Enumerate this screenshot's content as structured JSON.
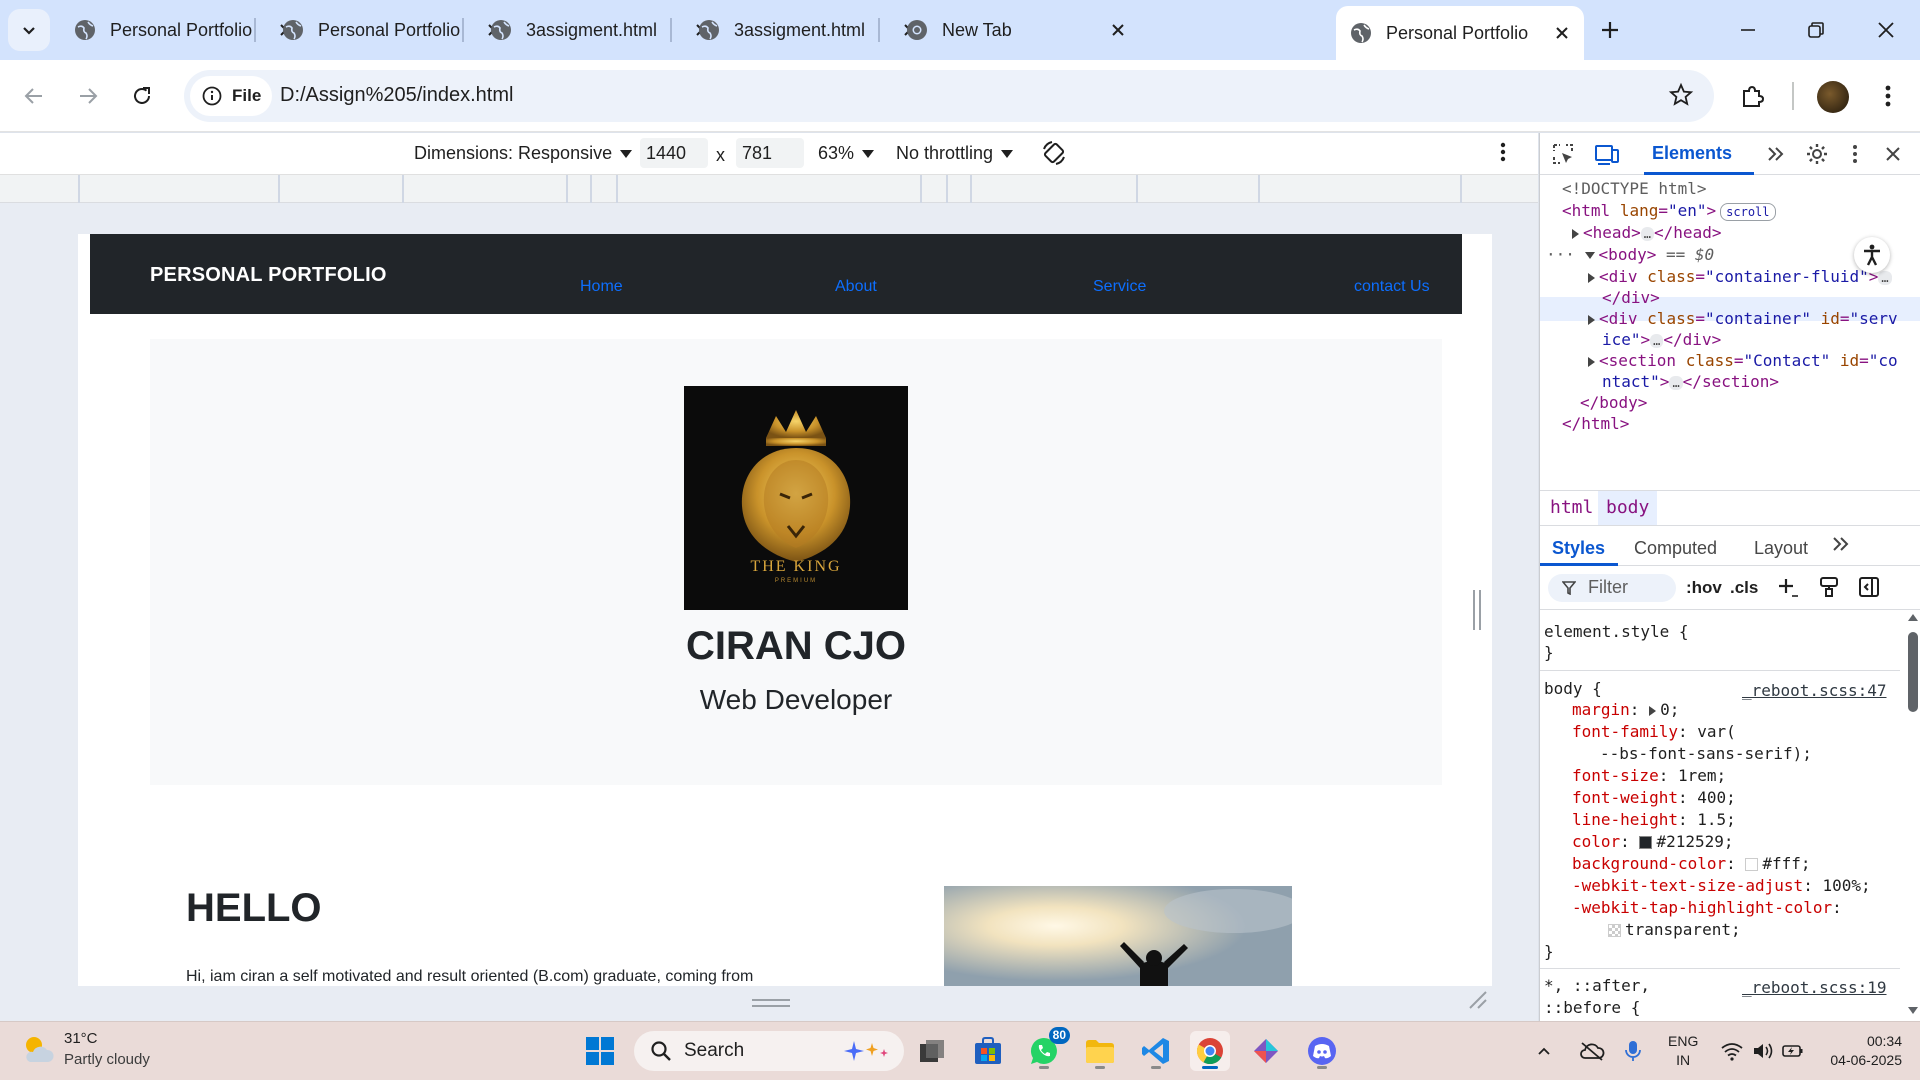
{
  "browser": {
    "tabs": [
      {
        "title": "Personal Portfolio",
        "active": false
      },
      {
        "title": "Personal Portfolio",
        "active": false
      },
      {
        "title": "3assigment.html",
        "active": false
      },
      {
        "title": "3assigment.html",
        "active": false
      },
      {
        "title": "New Tab",
        "active": false
      },
      {
        "title": "Personal Portfolio",
        "active": true
      }
    ],
    "address": {
      "chip": "File",
      "url": "D:/Assign%205/index.html"
    }
  },
  "device_toolbar": {
    "dimensions_label": "Dimensions: Responsive",
    "width": "1440",
    "times": "x",
    "height": "781",
    "zoom": "63%",
    "throttling": "No throttling"
  },
  "site": {
    "brand": "PERSONAL PORTFOLIO",
    "nav": [
      "Home",
      "About",
      "Service",
      "contact Us"
    ],
    "hero": {
      "logo_text": "THE KING",
      "logo_sub": "PREMIUM",
      "name": "CIRAN CJO",
      "role": "Web Developer"
    },
    "about": {
      "heading": "HELLO",
      "text": "Hi, iam ciran a self motivated and result oriented (B.com) graduate, coming from"
    }
  },
  "devtools": {
    "active_tab": "Elements",
    "dom": {
      "doctype": "<!DOCTYPE html>",
      "html_open_tag": "<html",
      "html_lang_attr": "lang",
      "html_lang_val": "\"en\"",
      "html_open_close": ">",
      "scroll_badge": "scroll",
      "head_open": "<head>",
      "head_close": "</head>",
      "body_open": "<body>",
      "body_eq": "== $0",
      "div1_tag": "<div",
      "div1_attr": "class",
      "div1_val": "\"container-fluid\"",
      "div1_end": ">",
      "div1_close": "</div>",
      "div2_tag": "<div",
      "div2_attr": "class",
      "div2_val": "\"container\"",
      "div2_attr2": "id",
      "div2_val2a": "\"serv",
      "div2_val2b": "ice\"",
      "div2_end": ">",
      "div2_close": "</div>",
      "section_tag": "<section",
      "section_attr": "class",
      "section_val": "\"Contact\"",
      "section_attr2": "id",
      "section_val2a": "\"co",
      "section_val2b": "ntact\"",
      "section_end": ">",
      "section_close": "</section>",
      "body_close": "</body>",
      "html_close": "</html>",
      "ellipsis": "…"
    },
    "breadcrumbs": [
      "html",
      "body"
    ],
    "style_tabs": [
      "Styles",
      "Computed",
      "Layout"
    ],
    "filter": {
      "placeholder": "Filter",
      "hov": ":hov",
      "cls": ".cls"
    },
    "element_style": "element.style {",
    "close_brace": "}",
    "rule1": {
      "selector": "body {",
      "source": "_reboot.scss:47",
      "props": [
        {
          "name": "margin",
          "value": "0;"
        },
        {
          "name": "font-family",
          "value": "var("
        },
        {
          "name": "",
          "value": "--bs-font-sans-serif);"
        },
        {
          "name": "font-size",
          "value": "1rem;"
        },
        {
          "name": "font-weight",
          "value": "400;"
        },
        {
          "name": "line-height",
          "value": "1.5;"
        },
        {
          "name": "color",
          "value": "#212529;"
        },
        {
          "name": "background-color",
          "value": "#fff;"
        },
        {
          "name": "-webkit-text-size-adjust",
          "value": "100%;"
        },
        {
          "name": "-webkit-tap-highlight-color",
          "value": ""
        },
        {
          "name": "",
          "value": "transparent;"
        }
      ]
    },
    "rule2": {
      "selector_a": "*, ::after,",
      "selector_b": "::before {",
      "source": "_reboot.scss:19"
    }
  },
  "taskbar": {
    "weather": {
      "temp": "31°C",
      "desc": "Partly cloudy"
    },
    "search": "Search",
    "whatsapp_badge": "80",
    "lang": {
      "line1": "ENG",
      "line2": "IN"
    },
    "clock": {
      "time": "00:34",
      "date": "04-06-2025"
    }
  },
  "colors": {
    "accent": "#0b57d0",
    "nav_bg": "#212529",
    "link": "#0d6efd",
    "tabstrip": "#d3e3fd"
  }
}
